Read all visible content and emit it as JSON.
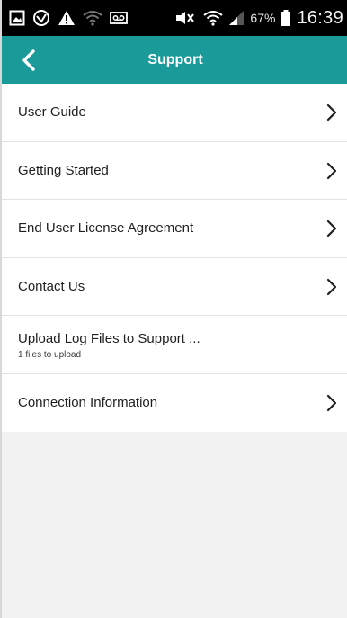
{
  "status_bar": {
    "battery_percent": "67%",
    "time": "16:39",
    "icons": [
      "gallery-icon",
      "vpn-icon",
      "warning-icon",
      "wifi-icon",
      "voicemail-icon",
      "mute-icon",
      "wifi-signal-icon",
      "cell-signal-icon",
      "battery-icon"
    ]
  },
  "app_bar": {
    "title": "Support",
    "back_icon": "chevron-left-icon",
    "color": "#1b9a9a"
  },
  "menu": {
    "items": [
      {
        "label": "User Guide",
        "has_chevron": true
      },
      {
        "label": "Getting Started",
        "has_chevron": true
      },
      {
        "label": "End User License Agreement",
        "has_chevron": true
      },
      {
        "label": "Contact Us",
        "has_chevron": true
      },
      {
        "label": "Upload Log Files to Support ...",
        "subtitle": "1 files to upload",
        "has_chevron": false
      },
      {
        "label": "Connection Information",
        "has_chevron": true
      }
    ]
  }
}
